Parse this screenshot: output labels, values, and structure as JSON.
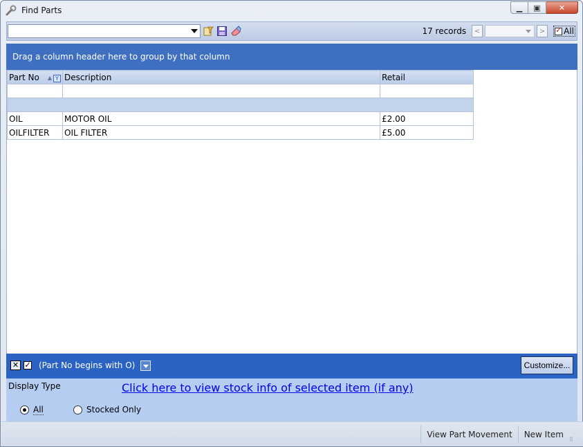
{
  "window": {
    "title": "Find Parts"
  },
  "toolbar": {
    "search_value": "",
    "records": "17 records",
    "page_value": "",
    "prev_label": "<",
    "next_label": ">",
    "all_label": "All",
    "all_checked": true
  },
  "grouping": {
    "hint": "Drag a column header here to group by that column"
  },
  "grid": {
    "columns": [
      "Part No",
      "Description",
      "Retail"
    ],
    "rows": [
      {
        "part_no": "OIL",
        "description": "MOTOR OIL",
        "retail": "£2.00"
      },
      {
        "part_no": "OILFILTER",
        "description": "OIL FILTER",
        "retail": "£5.00"
      }
    ]
  },
  "filter": {
    "text": "(Part No begins with O)",
    "customize_label": "Customize..."
  },
  "options": {
    "display_type_label": "Display Type",
    "stock_link": "Click here to view stock info of selected item (if any)",
    "radio_all": "All",
    "radio_stocked": "Stocked Only",
    "selected": "All"
  },
  "status": {
    "view_movement": "View Part Movement",
    "new_item": "New Item"
  },
  "icons": {
    "app": "wrench-icon",
    "filter": "filter-icon",
    "save": "save-icon",
    "clear": "eraser-icon"
  },
  "colors": {
    "accent": "#2a63c4",
    "group_panel": "#3f6fc1",
    "link": "#0000ee"
  }
}
